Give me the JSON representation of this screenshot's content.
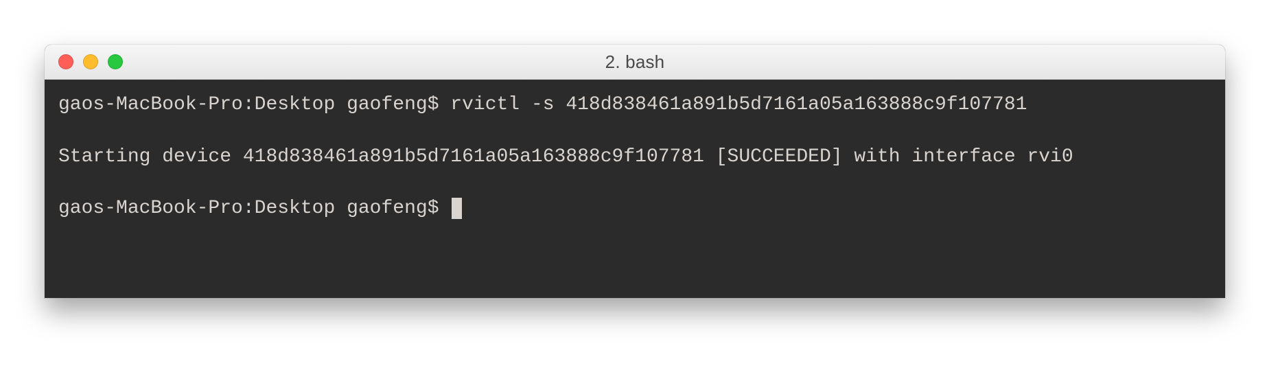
{
  "window": {
    "title": "2. bash"
  },
  "colors": {
    "titlebar_top": "#f6f6f6",
    "titlebar_bottom": "#e6e6e6",
    "terminal_bg": "#2b2b2b",
    "terminal_fg": "#d9d4cf",
    "close": "#ff5f57",
    "minimize": "#ffbd2e",
    "zoom": "#28c840"
  },
  "terminal": {
    "prompt1": "gaos-MacBook-Pro:Desktop gaofeng$ ",
    "command1": "rvictl -s 418d838461a891b5d7161a05a163888c9f107781",
    "output1": "Starting device 418d838461a891b5d7161a05a163888c9f107781 [SUCCEEDED] with interface rvi0",
    "prompt2": "gaos-MacBook-Pro:Desktop gaofeng$ "
  }
}
